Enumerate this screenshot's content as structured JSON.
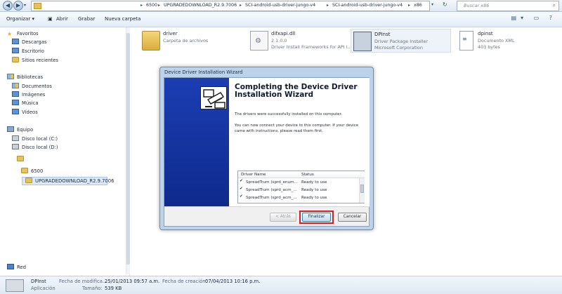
{
  "address": {
    "crumbs": [
      "6500",
      "UPGRADEDOWNLOAD_R2.9.7006",
      "SCI-android-usb-driver-jungo-v4",
      "SCI-android-usb-driver-jungo-v4",
      "x86"
    ],
    "search_placeholder": "Buscar x86"
  },
  "toolbar": {
    "organize": "Organizar ▾",
    "open": "Abrir",
    "burn": "Grabar",
    "new_folder": "Nueva carpeta"
  },
  "sidebar": {
    "favorites": "Favoritos",
    "downloads": "Descargas",
    "desktop": "Escritorio",
    "recent": "Sitios recientes",
    "libraries": "Bibliotecas",
    "documents": "Documentos",
    "images": "Imágenes",
    "music": "Música",
    "videos": "Vídeos",
    "computer": "Equipo",
    "disk_c": "Disco local (C:)",
    "disk_d": "Disco local (D:)",
    "folder_6500": "6500",
    "folder_upgrade": "UPGRADEDOWNLOAD_R2.9.7006",
    "network": "Red"
  },
  "files": [
    {
      "name": "driver",
      "line2": "Carpeta de archivos",
      "line3": ""
    },
    {
      "name": "difxapi.dll",
      "line2": "2.1.0.0",
      "line3": "Driver Install Frameworks for API l..."
    },
    {
      "name": "DPInst",
      "line2": "Driver Package Installer",
      "line3": "Microsoft Corporation"
    },
    {
      "name": "dpinst",
      "line2": "Documento XML",
      "line3": "403 bytes"
    }
  ],
  "dialog": {
    "title": "Device Driver Installation Wizard",
    "heading": "Completing the Device Driver Installation Wizard",
    "message1": "The drivers were successfully installed on this computer.",
    "message2": "You can now connect your device to this computer. If your device came with instructions, please read them first.",
    "col_name": "Driver Name",
    "col_status": "Status",
    "rows": [
      {
        "name": "SpreadTrum (sprd_enum...",
        "status": "Ready to use"
      },
      {
        "name": "SpreadTrum (sprd_acm_...",
        "status": "Ready to use"
      },
      {
        "name": "SpreadTrum (sprd_acm_...",
        "status": "Ready to use"
      }
    ],
    "back": "< Atrás",
    "finish": "Finalizar",
    "cancel": "Cancelar"
  },
  "details": {
    "name": "DPInst",
    "type": "Aplicación",
    "modified_label": "Fecha de modifica...",
    "modified_value": "25/01/2013 09:57 a.m.",
    "created_label": "Fecha de creación:",
    "created_value": "07/04/2013 10:16 p.m.",
    "size_label": "Tamaño:",
    "size_value": "539 KB"
  },
  "colors": {
    "highlight_box": "#d32027",
    "banner_blue": "#1c3eb3",
    "check_green": "#2f9a2f"
  }
}
